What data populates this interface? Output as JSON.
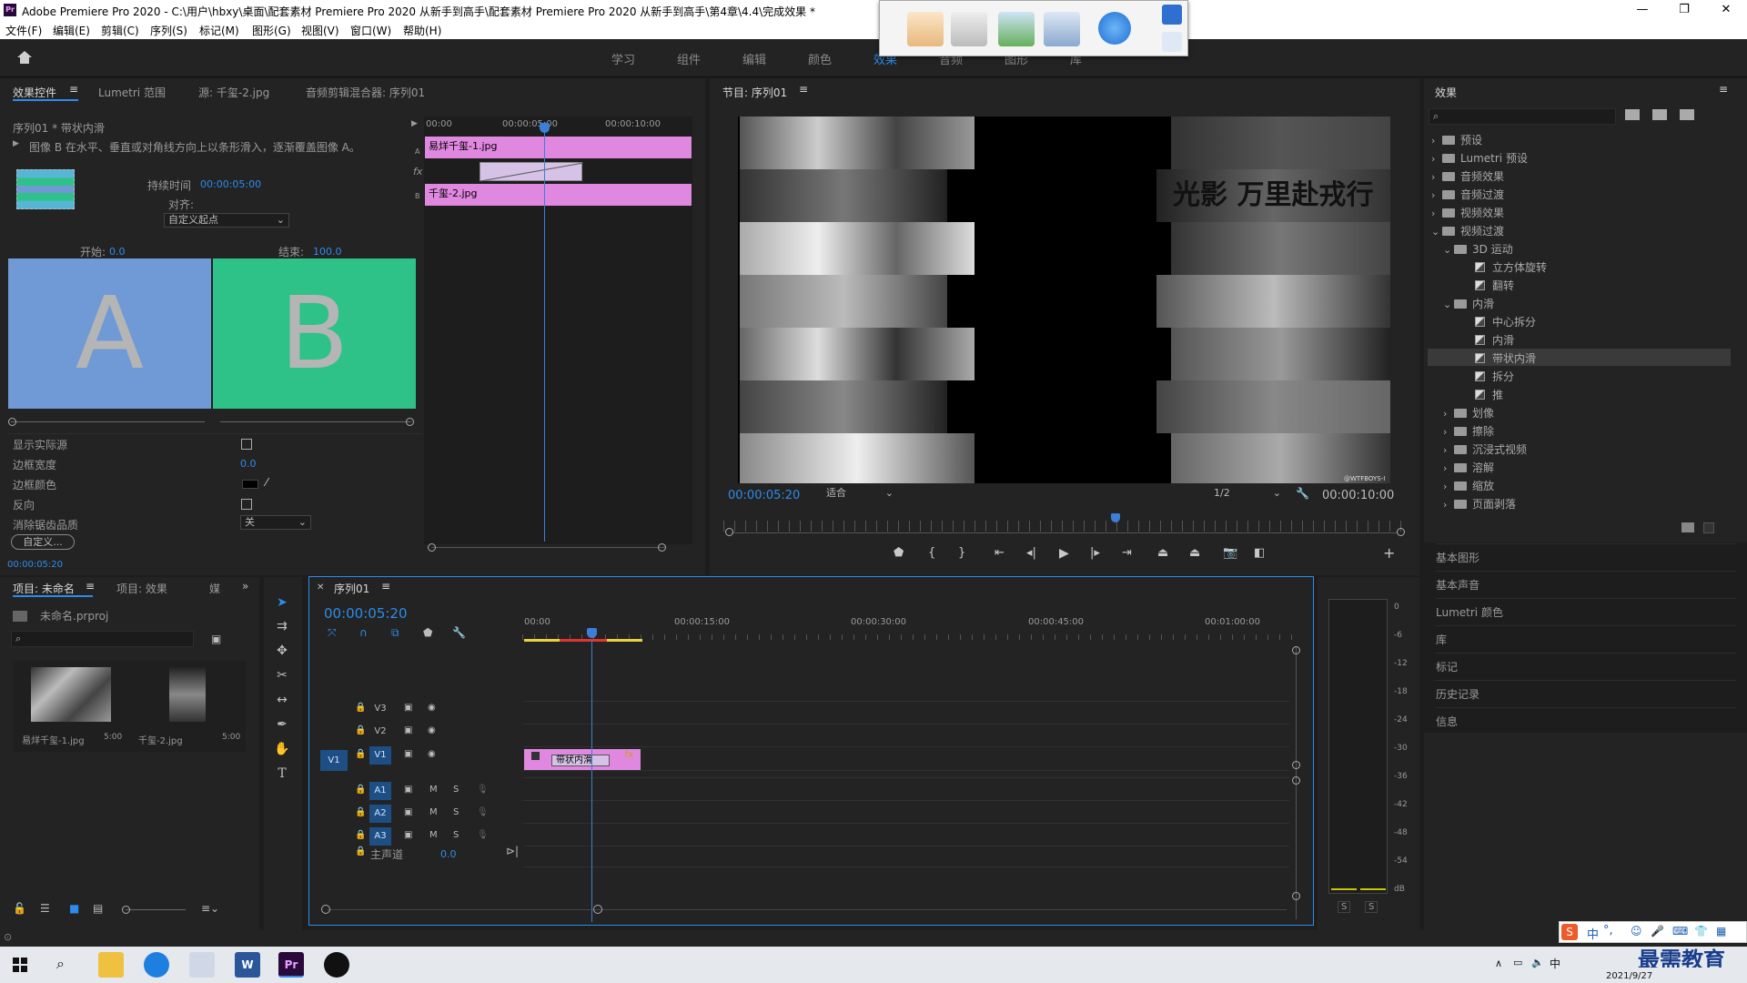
{
  "window": {
    "title": "Adobe Premiere Pro 2020 - C:\\用户\\hbxy\\桌面\\配套素材 Premiere Pro 2020 从新手到高手\\配套素材 Premiere Pro 2020 从新手到高手\\第4章\\4.4\\完成效果 *",
    "app_icon": "Pr",
    "minimize": "—",
    "maximize": "❐",
    "close": "✕"
  },
  "menu": [
    "文件(F)",
    "编辑(E)",
    "剪辑(C)",
    "序列(S)",
    "标记(M)",
    "图形(G)",
    "视图(V)",
    "窗口(W)",
    "帮助(H)"
  ],
  "workspaces": [
    "学习",
    "组件",
    "编辑",
    "颜色",
    "效果",
    "音频",
    "图形",
    "库"
  ],
  "effect_controls": {
    "tabs": [
      "效果控件",
      "Lumetri 范围",
      "源: 千玺-2.jpg",
      "音频剪辑混合器: 序列01"
    ],
    "clip_path": "序列01 * 带状内滑",
    "description": "图像 B 在水平、垂直或对角线方向上以条形滑入，逐渐覆盖图像 A。",
    "duration_label": "持续时间",
    "duration_value": "00:00:05:00",
    "align_label": "对齐:",
    "align_value": "自定义起点",
    "start_label": "开始:",
    "start_value": "0.0",
    "end_label": "结束:",
    "end_value": "100.0",
    "preview_a": "A",
    "preview_b": "B",
    "props": [
      {
        "label": "显示实际源",
        "type": "checkbox"
      },
      {
        "label": "边框宽度",
        "value": "0.0"
      },
      {
        "label": "边框颜色",
        "type": "color"
      },
      {
        "label": "反向",
        "type": "checkbox"
      },
      {
        "label": "消除锯齿品质",
        "value": "关"
      }
    ],
    "custom_button": "自定义...",
    "timecode": "00:00:05:20",
    "mini_ruler": [
      "00:00",
      "00:00:05:00",
      "00:00:10:00"
    ],
    "mini_clips": {
      "a": "易烊千玺-1.jpg",
      "b": "千玺-2.jpg"
    },
    "track_a": "A",
    "track_b": "B",
    "fx_label": "fx"
  },
  "program": {
    "title": "节目: 序列01",
    "timecode_current": "00:00:05:20",
    "fit": "适合",
    "resolution": "1/2",
    "timecode_total": "00:00:10:00",
    "watermark": "@WTFBOYS-I",
    "poster_text": "光影 万里赴戎行"
  },
  "project": {
    "tabs": [
      "项目: 未命名",
      "项目: 效果",
      "媒"
    ],
    "file": "未命名.prproj",
    "items": [
      {
        "name": "易烊千玺-1.jpg",
        "dur": "5:00"
      },
      {
        "name": "千玺-2.jpg",
        "dur": "5:00"
      }
    ]
  },
  "timeline": {
    "tab": "序列01",
    "timecode": "00:00:05:20",
    "ruler": [
      "00:00",
      "00:00:15:00",
      "00:00:30:00",
      "00:00:45:00",
      "00:01:00:00"
    ],
    "video_tracks": [
      "V3",
      "V2",
      "V1"
    ],
    "audio_tracks": [
      "A1",
      "A2",
      "A3"
    ],
    "master": "主声道",
    "master_value": "0.0",
    "source_patch": "V1",
    "transition_label": "带状内滑",
    "mute": "M",
    "solo": "S"
  },
  "effects_panel": {
    "title": "效果",
    "tree": [
      {
        "label": "预设",
        "level": 0,
        "kind": "folder",
        "open": false
      },
      {
        "label": "Lumetri 预设",
        "level": 0,
        "kind": "folder",
        "open": false
      },
      {
        "label": "音频效果",
        "level": 0,
        "kind": "folder",
        "open": false
      },
      {
        "label": "音频过渡",
        "level": 0,
        "kind": "folder",
        "open": false
      },
      {
        "label": "视频效果",
        "level": 0,
        "kind": "folder",
        "open": false
      },
      {
        "label": "视频过渡",
        "level": 0,
        "kind": "folder",
        "open": true
      },
      {
        "label": "3D 运动",
        "level": 1,
        "kind": "folder",
        "open": true
      },
      {
        "label": "立方体旋转",
        "level": 2,
        "kind": "fx"
      },
      {
        "label": "翻转",
        "level": 2,
        "kind": "fx"
      },
      {
        "label": "内滑",
        "level": 1,
        "kind": "folder",
        "open": true
      },
      {
        "label": "中心拆分",
        "level": 2,
        "kind": "fx"
      },
      {
        "label": "内滑",
        "level": 2,
        "kind": "fx"
      },
      {
        "label": "带状内滑",
        "level": 2,
        "kind": "fx",
        "selected": true
      },
      {
        "label": "拆分",
        "level": 2,
        "kind": "fx"
      },
      {
        "label": "推",
        "level": 2,
        "kind": "fx"
      },
      {
        "label": "划像",
        "level": 1,
        "kind": "folder",
        "open": false
      },
      {
        "label": "擦除",
        "level": 1,
        "kind": "folder",
        "open": false
      },
      {
        "label": "沉浸式视频",
        "level": 1,
        "kind": "folder",
        "open": false
      },
      {
        "label": "溶解",
        "level": 1,
        "kind": "folder",
        "open": false
      },
      {
        "label": "缩放",
        "level": 1,
        "kind": "folder",
        "open": false
      },
      {
        "label": "页面剥落",
        "level": 1,
        "kind": "folder",
        "open": false
      }
    ],
    "sections": [
      "基本图形",
      "基本声音",
      "Lumetri 颜色",
      "库",
      "标记",
      "历史记录",
      "信息"
    ]
  },
  "audio_meter": {
    "scale": [
      "0",
      "-6",
      "-12",
      "-18",
      "-24",
      "-30",
      "-36",
      "-42",
      "-48",
      "-54",
      "dB"
    ],
    "solo_labels": [
      "S",
      "S"
    ]
  },
  "taskbar": {
    "date": "2021/9/27",
    "brand": "最需教育",
    "ime": "中",
    "ime_extra": "°,"
  },
  "colors": {
    "accent_blue": "#2d8ceb",
    "clip_pink": "#e088e0",
    "preview_a": "#6f9ad6",
    "preview_b": "#2ec289",
    "playhead": "#3b7fd8"
  }
}
